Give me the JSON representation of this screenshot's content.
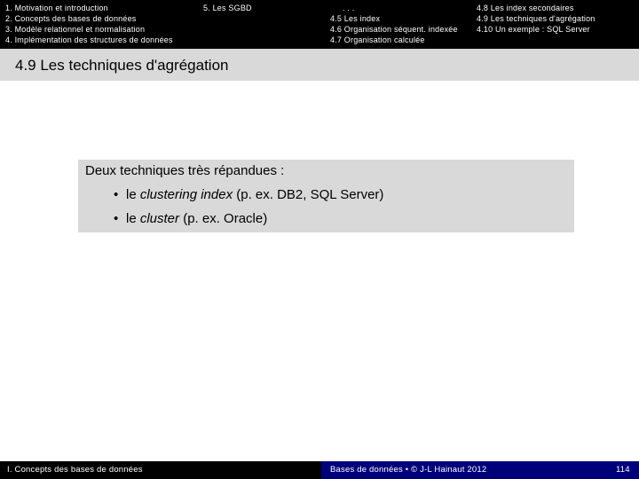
{
  "header": {
    "chapters": [
      "1. Motivation et introduction",
      "2. Concepts des bases de données",
      "3. Modèle relationnel et normalisation",
      "4. Implémentation des structures de données"
    ],
    "chapter5": "5. Les SGBD",
    "sections_mid": [
      ". . .",
      "4.5 Les index",
      "4.6 Organisation séquent. indexée",
      "4.7 Organisation calculée"
    ],
    "sections_right": [
      "4.8 Les index secondaires",
      "4.9 Les techniques d'agrégation",
      "4.10 Un exemple : SQL Server"
    ]
  },
  "slide": {
    "title": "4.9 Les techniques d'agrégation",
    "intro": "Deux techniques très répandues :",
    "bullets": [
      {
        "prefix": "le ",
        "term": "clustering index",
        "suffix": " (p. ex. DB2, SQL Server)"
      },
      {
        "prefix": "le ",
        "term": "cluster",
        "suffix": " (p. ex. Oracle)"
      }
    ],
    "bullet_glyph": "•"
  },
  "footer": {
    "left": "I. Concepts des bases de données",
    "center": "Bases de données • © J-L Hainaut 2012",
    "page": "114"
  },
  "colors": {
    "bars": "#000000",
    "footer_panel": "#00007a",
    "band": "#d9d9d9"
  }
}
